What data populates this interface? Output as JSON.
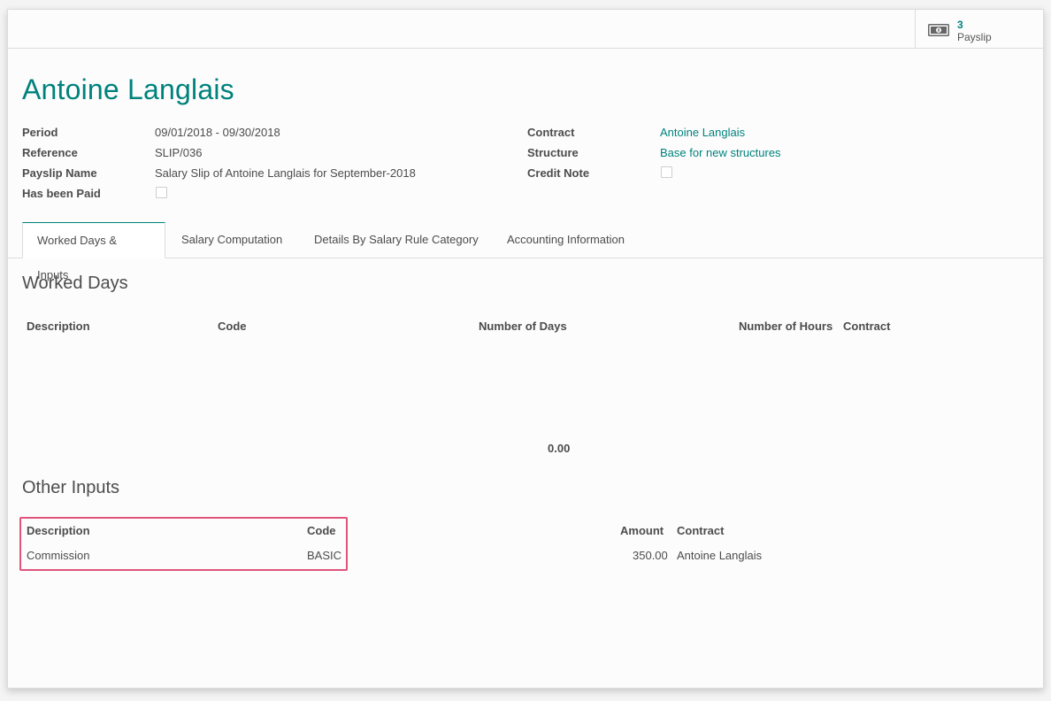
{
  "smart_button": {
    "count": "3",
    "label": "Payslip",
    "icon": "money-icon"
  },
  "employee_name": "Antoine Langlais",
  "fields_left": [
    {
      "label": "Period",
      "value": "09/01/2018 - 09/30/2018"
    },
    {
      "label": "Reference",
      "value": "SLIP/036"
    },
    {
      "label": "Payslip Name",
      "value": "Salary Slip of Antoine Langlais for September-2018"
    },
    {
      "label": "Has been Paid",
      "checked": false
    }
  ],
  "fields_right": [
    {
      "label": "Contract",
      "value": "Antoine Langlais"
    },
    {
      "label": "Structure",
      "value": "Base for new structures"
    },
    {
      "label": "Credit Note",
      "checked": false
    }
  ],
  "tabs": [
    {
      "label": "Worked Days & Inputs",
      "active": true
    },
    {
      "label": "Salary Computation"
    },
    {
      "label": "Details By Salary Rule Category"
    },
    {
      "label": "Accounting Information"
    }
  ],
  "worked_days": {
    "title": "Worked Days",
    "columns": [
      "Description",
      "Code",
      "Number of Days",
      "Number of Hours",
      "Contract"
    ],
    "rows": [],
    "total_days": "0.00"
  },
  "other_inputs": {
    "title": "Other Inputs",
    "columns": [
      "Description",
      "Code",
      "Amount",
      "Contract"
    ],
    "rows": [
      {
        "description": "Commission",
        "code": "BASIC",
        "amount": "350.00",
        "contract": "Antoine Langlais"
      }
    ]
  },
  "colors": {
    "accent": "#00827c",
    "highlight": "#e05479"
  }
}
